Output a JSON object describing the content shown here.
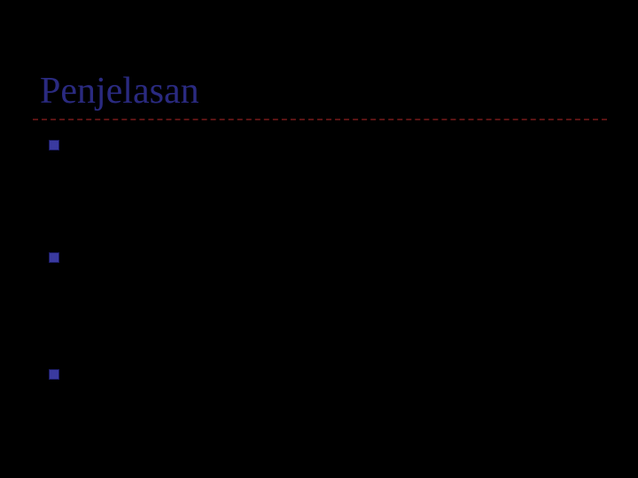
{
  "slide": {
    "title": "Penjelasan",
    "bullets": [
      {
        "text": ""
      },
      {
        "text": ""
      },
      {
        "text": ""
      }
    ]
  }
}
